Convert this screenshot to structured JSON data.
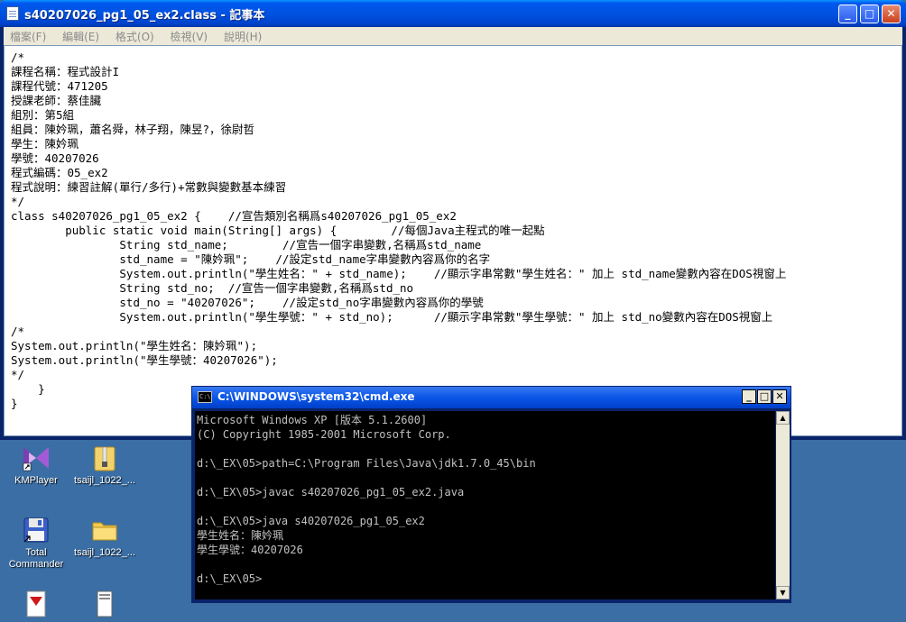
{
  "notepad": {
    "title": "s40207026_pg1_05_ex2.class - 記事本",
    "menu": [
      "檔案(F)",
      "編輯(E)",
      "格式(O)",
      "檢視(V)",
      "說明(H)"
    ],
    "lines": [
      "/*",
      "課程名稱：程式設計I",
      "課程代號：471205",
      "授課老師：蔡佳臟",
      "組別：第5組",
      "組員：陳妗珮，蕭名舜，林子翔，陳昱?，徐尉哲",
      "學生：陳妗珮",
      "學號：40207026",
      "程式編碼：05_ex2",
      "程式說明：練習註解(單行/多行)+常數與變數基本練習",
      "*/",
      "class s40207026_pg1_05_ex2 {    //宣告類別名稱爲s40207026_pg1_05_ex2",
      "        public static void main(String[] args) {        //每個Java主程式的唯一起點",
      "                String std_name;        //宣告一個字串變數,名稱爲std_name",
      "                std_name = \"陳妗珮\";    //設定std_name字串變數內容爲你的名字",
      "                System.out.println(\"學生姓名：\" + std_name);    //顯示字串常數\"學生姓名：\" 加上 std_name變數內容在DOS視窗上",
      "                String std_no;  //宣告一個字串變數,名稱爲std_no",
      "                std_no = \"40207026\";    //設定std_no字串變數內容爲你的學號",
      "                System.out.println(\"學生學號：\" + std_no);      //顯示字串常數\"學生學號：\" 加上 std_no變數內容在DOS視窗上",
      "/*",
      "System.out.println(\"學生姓名：陳妗珮\");",
      "System.out.println(\"學生學號：40207026\");",
      "*/",
      "    }",
      "}"
    ]
  },
  "desktop": {
    "icons": [
      {
        "name": "kmplayer",
        "label": "KMPlayer"
      },
      {
        "name": "zip-folder",
        "label": "tsaijl_1022_..."
      },
      {
        "name": "total-commander",
        "label": "Total Commander"
      },
      {
        "name": "folder",
        "label": "tsaijl_1022_..."
      }
    ]
  },
  "cmd": {
    "title": "C:\\WINDOWS\\system32\\cmd.exe",
    "lines": [
      "Microsoft Windows XP [版本 5.1.2600]",
      "(C) Copyright 1985-2001 Microsoft Corp.",
      "",
      "d:\\_EX\\05>path=C:\\Program Files\\Java\\jdk1.7.0_45\\bin",
      "",
      "d:\\_EX\\05>javac s40207026_pg1_05_ex2.java",
      "",
      "d:\\_EX\\05>java s40207026_pg1_05_ex2",
      "學生姓名：陳妗珮",
      "學生學號：40207026",
      "",
      "d:\\_EX\\05>"
    ]
  }
}
